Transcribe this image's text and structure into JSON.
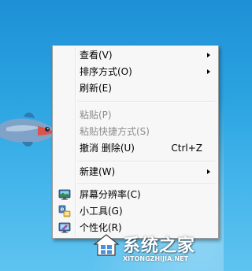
{
  "context_menu": {
    "items": [
      {
        "label": "查看(V)",
        "has_submenu": true,
        "enabled": true
      },
      {
        "label": "排序方式(O)",
        "has_submenu": true,
        "enabled": true
      },
      {
        "label": "刷新(E)",
        "has_submenu": false,
        "enabled": true
      },
      {
        "label": "粘贴(P)",
        "has_submenu": false,
        "enabled": false
      },
      {
        "label": "粘贴快捷方式(S)",
        "has_submenu": false,
        "enabled": false
      },
      {
        "label": "撤消 删除(U)",
        "shortcut": "Ctrl+Z",
        "has_submenu": false,
        "enabled": true
      },
      {
        "label": "新建(W)",
        "has_submenu": true,
        "enabled": true
      },
      {
        "label": "屏幕分辨率(C)",
        "icon": "screen-resolution-icon",
        "has_submenu": false,
        "enabled": true
      },
      {
        "label": "小工具(G)",
        "icon": "gadgets-icon",
        "has_submenu": false,
        "enabled": true
      },
      {
        "label": "个性化(R)",
        "icon": "personalize-icon",
        "has_submenu": false,
        "enabled": true
      }
    ]
  },
  "watermark": {
    "brand": "系统之家",
    "url": "XITONGZHIJIA.NET"
  },
  "colors": {
    "desktop_top": "#1e90d6",
    "desktop_bottom": "#5fc3f0",
    "menu_background": "#f7f7f7",
    "menu_border": "#9a9a9a",
    "disabled_text": "#8d8d8d"
  }
}
